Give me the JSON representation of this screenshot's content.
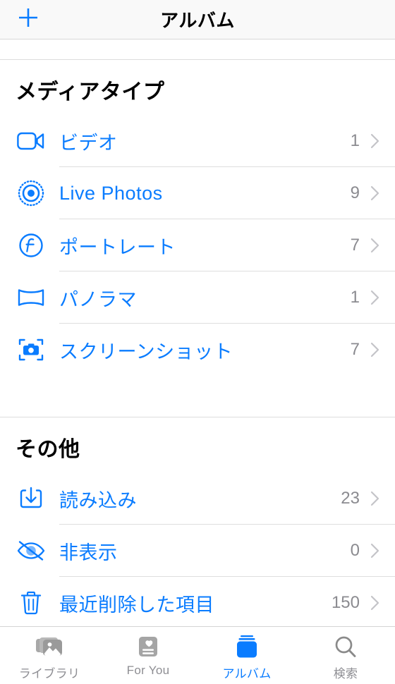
{
  "colors": {
    "accent": "#0a7cff",
    "count_gray": "#8b8b90",
    "inactive_gray": "#8e8e93",
    "separator": "#dedede",
    "navbar_bg": "#f9f9f9"
  },
  "navbar": {
    "add_button_label": "+",
    "add_button_icon": "plus-icon",
    "title": "アルバム"
  },
  "sections": [
    {
      "header": "メディアタイプ",
      "rows": [
        {
          "icon": "video-camera-icon",
          "label": "ビデオ",
          "count": "1",
          "chevron": "chevron-right-icon"
        },
        {
          "icon": "live-photos-icon",
          "label": "Live Photos",
          "count": "9",
          "chevron": "chevron-right-icon"
        },
        {
          "icon": "portrait-aperture-icon",
          "label": "ポートレート",
          "count": "7",
          "chevron": "chevron-right-icon"
        },
        {
          "icon": "panorama-icon",
          "label": "パノラマ",
          "count": "1",
          "chevron": "chevron-right-icon"
        },
        {
          "icon": "screenshot-camera-icon",
          "label": "スクリーンショット",
          "count": "7",
          "chevron": "chevron-right-icon"
        }
      ]
    },
    {
      "header": "その他",
      "rows": [
        {
          "icon": "import-download-icon",
          "label": "読み込み",
          "count": "23",
          "chevron": "chevron-right-icon"
        },
        {
          "icon": "eye-slash-icon",
          "label": "非表示",
          "count": "0",
          "chevron": "chevron-right-icon"
        },
        {
          "icon": "trash-icon",
          "label": "最近削除した項目",
          "count": "150",
          "chevron": "chevron-right-icon"
        }
      ]
    }
  ],
  "tabbar": {
    "tabs": [
      {
        "icon": "photo-stack-icon",
        "label": "ライブラリ",
        "active": false
      },
      {
        "icon": "for-you-card-icon",
        "label": "For You",
        "active": false
      },
      {
        "icon": "albums-stack-icon",
        "label": "アルバム",
        "active": true
      },
      {
        "icon": "search-magnifier-icon",
        "label": "検索",
        "active": false
      }
    ]
  }
}
